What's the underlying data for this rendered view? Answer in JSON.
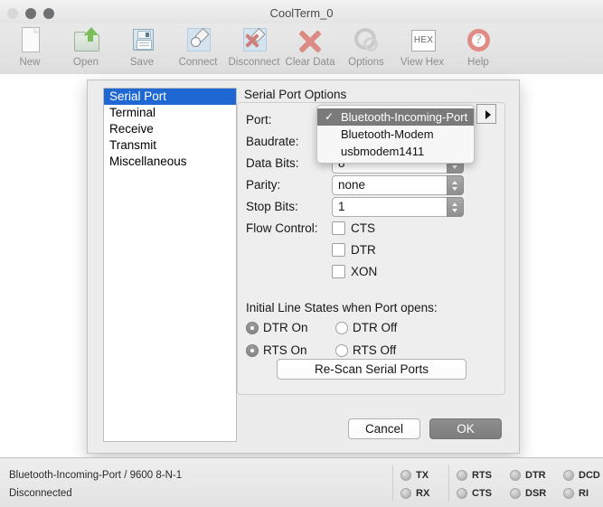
{
  "window": {
    "title": "CoolTerm_0",
    "traffic_lights": [
      "close",
      "minimize",
      "maximize"
    ]
  },
  "toolbar": {
    "items": [
      {
        "label": "New",
        "icon": "new-document-icon"
      },
      {
        "label": "Open",
        "icon": "open-folder-icon"
      },
      {
        "label": "Save",
        "icon": "save-floppy-icon"
      },
      {
        "label": "Connect",
        "icon": "connect-plug-icon"
      },
      {
        "label": "Disconnect",
        "icon": "disconnect-plug-icon"
      },
      {
        "label": "Clear Data",
        "icon": "clear-data-x-icon"
      },
      {
        "label": "Options",
        "icon": "options-gear-icon"
      },
      {
        "label": "View Hex",
        "icon": "view-hex-icon"
      },
      {
        "label": "Help",
        "icon": "help-lifering-icon"
      }
    ],
    "hex_glyph": "HEX",
    "help_glyph": "?"
  },
  "dialog": {
    "categories": [
      "Serial Port",
      "Terminal",
      "Receive",
      "Transmit",
      "Miscellaneous"
    ],
    "selected_category": "Serial Port",
    "panel_title": "Serial Port Options",
    "fields": [
      {
        "label": "Port:",
        "value": "Bluetooth-Incoming-Port"
      },
      {
        "label": "Baudrate:",
        "value": "9600"
      },
      {
        "label": "Data Bits:",
        "value": "8"
      },
      {
        "label": "Parity:",
        "value": "none"
      },
      {
        "label": "Stop Bits:",
        "value": "1"
      }
    ],
    "flow_control": {
      "label": "Flow Control:",
      "options": [
        {
          "label": "CTS",
          "checked": false
        },
        {
          "label": "DTR",
          "checked": false
        },
        {
          "label": "XON",
          "checked": false
        }
      ]
    },
    "line_states": {
      "title": "Initial Line States when Port opens:",
      "options": [
        {
          "label": "DTR On",
          "selected": true
        },
        {
          "label": "DTR Off",
          "selected": false
        },
        {
          "label": "RTS On",
          "selected": true
        },
        {
          "label": "RTS Off",
          "selected": false
        }
      ]
    },
    "rescan_label": "Re-Scan Serial Ports",
    "cancel_label": "Cancel",
    "ok_label": "OK"
  },
  "port_popup": {
    "items": [
      {
        "label": "Bluetooth-Incoming-Port",
        "selected": true,
        "check": "✓"
      },
      {
        "label": "Bluetooth-Modem",
        "selected": false,
        "check": ""
      },
      {
        "label": "usbmodem1411",
        "selected": false,
        "check": ""
      }
    ]
  },
  "statusbar": {
    "line1": "Bluetooth-Incoming-Port / 9600 8-N-1",
    "line2": "Disconnected",
    "leds_group1": [
      "TX",
      "RX"
    ],
    "leds_group2": [
      "RTS",
      "CTS"
    ],
    "leds_group3": [
      "DTR",
      "DSR"
    ],
    "leds_group4": [
      "DCD",
      "RI"
    ]
  },
  "colors": {
    "selection_blue": "#1f67d2",
    "popup_selected_gray": "#7a7a7a",
    "ok_button_gray": "#7d7d7d",
    "icon_red": "#dc8b84",
    "icon_green": "#7bbf5d"
  }
}
